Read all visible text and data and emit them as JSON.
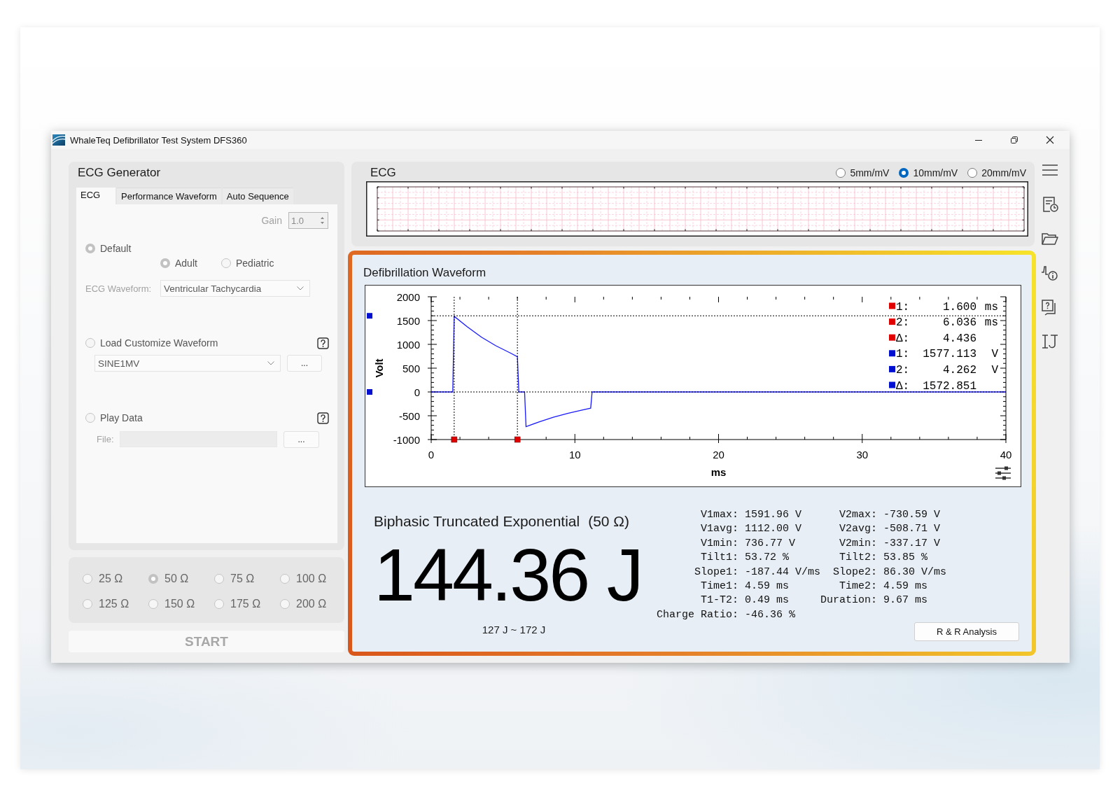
{
  "window": {
    "title": "WhaleTeq Defibrillator Test System DFS360"
  },
  "ecg_generator": {
    "title": "ECG Generator",
    "disabled": true,
    "tabs": [
      {
        "label": "ECG",
        "selected": true
      },
      {
        "label": "Performance Waveform",
        "selected": false
      },
      {
        "label": "Auto Sequence",
        "selected": false
      }
    ],
    "gain": {
      "label": "Gain",
      "value": "1.0"
    },
    "sources": [
      {
        "kind": "default",
        "label": "Default",
        "selected": true,
        "patients": [
          {
            "label": "Adult",
            "selected": true
          },
          {
            "label": "Pediatric",
            "selected": false
          }
        ],
        "waveform": {
          "label": "ECG Waveform:",
          "value": "Ventricular Tachycardia"
        }
      },
      {
        "kind": "custom",
        "label": "Load Customize Waveform",
        "selected": false,
        "file": {
          "value": "SINE1MV"
        },
        "browse": "..."
      },
      {
        "kind": "play",
        "label": "Play Data",
        "selected": false,
        "file": {
          "label": "File:"
        },
        "browse": "..."
      }
    ]
  },
  "resistance": {
    "disabled": true,
    "options": [
      {
        "label": "25 Ω",
        "selected": false
      },
      {
        "label": "50 Ω",
        "selected": true
      },
      {
        "label": "75 Ω",
        "selected": false
      },
      {
        "label": "100 Ω",
        "selected": false
      },
      {
        "label": "125 Ω",
        "selected": false
      },
      {
        "label": "150 Ω",
        "selected": false
      },
      {
        "label": "175 Ω",
        "selected": false
      },
      {
        "label": "200 Ω",
        "selected": false
      }
    ]
  },
  "start_button": {
    "label": "START",
    "disabled": true
  },
  "ecg_view": {
    "title": "ECG",
    "scales": [
      {
        "label": "5mm/mV",
        "selected": false
      },
      {
        "label": "10mm/mV",
        "selected": true
      },
      {
        "label": "20mm/mV",
        "selected": false
      }
    ]
  },
  "defibrillation": {
    "title": "Defibrillation Waveform",
    "chart_data": {
      "type": "line",
      "xlabel": "ms",
      "ylabel": "Volt",
      "x": [
        0,
        1.5,
        1.6,
        2.5,
        3.5,
        4.5,
        5.5,
        6.0,
        6.1,
        6.5,
        6.6,
        7.5,
        8.5,
        9.5,
        10.5,
        11.1,
        11.2,
        40
      ],
      "series": [
        {
          "color": "#1a1aff",
          "values": [
            0,
            0,
            1590,
            1370,
            1150,
            970,
            820,
            740,
            0,
            0,
            -730,
            -630,
            -530,
            -450,
            -380,
            -340,
            0,
            0
          ]
        }
      ],
      "xlim": [
        0,
        40
      ],
      "ylim": [
        -1000,
        2000
      ],
      "xticks": [
        0,
        10,
        20,
        30,
        40
      ],
      "yticks": [
        -1000,
        -500,
        0,
        500,
        1000,
        1500,
        2000
      ],
      "ref_lines": [
        {
          "axis": "x",
          "value": 1.6
        },
        {
          "axis": "x",
          "value": 6.0
        },
        {
          "axis": "y",
          "value": 1600
        },
        {
          "axis": "y",
          "value": 0
        }
      ]
    },
    "readouts": [
      {
        "color": "#e00000",
        "label": "1:",
        "value": "1.600",
        "unit": "ms"
      },
      {
        "color": "#e00000",
        "label": "2:",
        "value": "6.036",
        "unit": "ms"
      },
      {
        "color": "#e00000",
        "label": "Δ:",
        "value": "4.436"
      },
      {
        "color": "#0010d0",
        "label": "1:",
        "value": "1577.113",
        "unit": "V"
      },
      {
        "color": "#0010d0",
        "label": "2:",
        "value": "4.262",
        "unit": "V"
      },
      {
        "color": "#0010d0",
        "label": "Δ:",
        "value": "1572.851"
      }
    ],
    "waveform_type": "Biphasic Truncated Exponential",
    "load": "(50 Ω)",
    "energy": "144.36 J",
    "range": "127 J ~ 172 J",
    "stats": [
      [
        {
          "label": "V1max:",
          "value": "1591.96 V"
        },
        {
          "label": "V2max:",
          "value": "-730.59 V"
        }
      ],
      [
        {
          "label": "V1avg:",
          "value": "1112.00 V"
        },
        {
          "label": "V2avg:",
          "value": "-508.71 V"
        }
      ],
      [
        {
          "label": "V1min:",
          "value": "736.77 V"
        },
        {
          "label": "V2min:",
          "value": "-337.17 V"
        }
      ],
      [
        {
          "label": "Tilt1:",
          "value": "53.72 %"
        },
        {
          "label": "Tilt2:",
          "value": "53.85 %"
        }
      ],
      [
        {
          "label": "Slope1:",
          "value": "-187.44 V/ms"
        },
        {
          "label": "Slope2:",
          "value": "86.30 V/ms"
        }
      ],
      [
        {
          "label": "Time1:",
          "value": "4.59 ms"
        },
        {
          "label": "Time2:",
          "value": "4.59 ms"
        }
      ],
      [
        {
          "label": "T1-T2:",
          "value": "0.49 ms"
        },
        {
          "label": "Duration:",
          "value": "9.67 ms"
        }
      ],
      [
        {
          "label": "Charge Ratio:",
          "value": "-46.36 %"
        }
      ]
    ],
    "analysis_button": "R & R Analysis"
  }
}
